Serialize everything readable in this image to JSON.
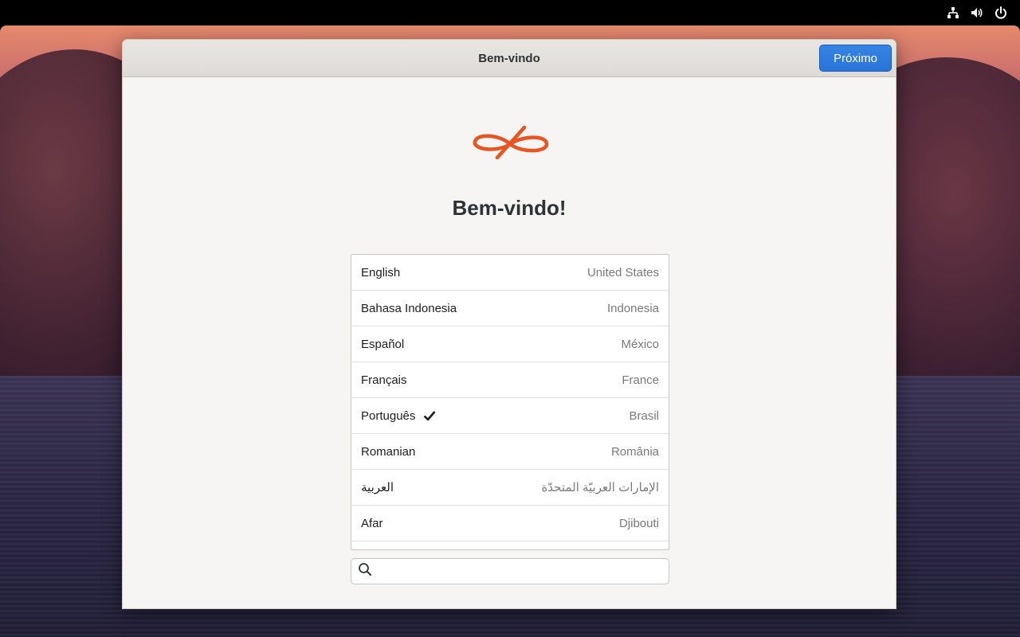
{
  "window": {
    "title": "Bem-vindo",
    "next_label": "Próximo"
  },
  "welcome": {
    "heading": "Bem-vindo!"
  },
  "languages": [
    {
      "name": "English",
      "region": "United States",
      "selected": false
    },
    {
      "name": "Bahasa Indonesia",
      "region": "Indonesia",
      "selected": false
    },
    {
      "name": "Español",
      "region": "México",
      "selected": false
    },
    {
      "name": "Français",
      "region": "France",
      "selected": false
    },
    {
      "name": "Português",
      "region": "Brasil",
      "selected": true
    },
    {
      "name": "Romanian",
      "region": "România",
      "selected": false
    },
    {
      "name": "العربية",
      "region": "الإمارات العربيّة المتحدّة",
      "selected": false
    },
    {
      "name": "Afar",
      "region": "Djibouti",
      "selected": false
    }
  ],
  "search": {
    "placeholder": "",
    "value": ""
  },
  "topbar_icons": [
    "network-icon",
    "volume-icon",
    "power-icon"
  ],
  "colors": {
    "accent": "#3584e4",
    "logo": "#e95420",
    "topbar": "#000000"
  }
}
